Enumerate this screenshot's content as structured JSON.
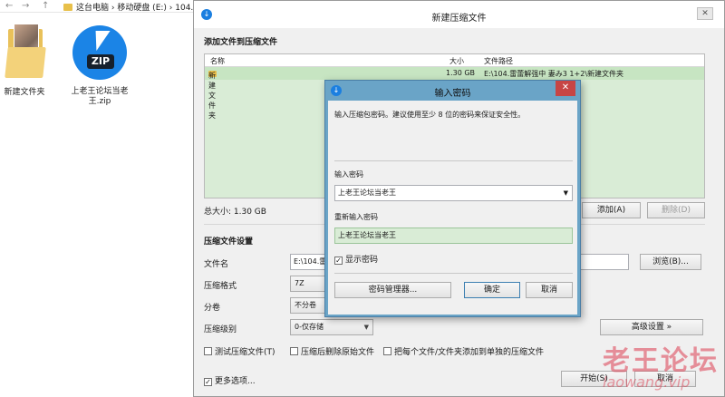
{
  "explorer": {
    "breadcrumb": "这台电脑 › 移动硬盘 (E:) › 104.雷蕾解强中",
    "desktop_items": [
      {
        "label": "新建文件夹"
      },
      {
        "label": "上老王论坛当老王.zip"
      }
    ],
    "zip_badge": "ZIP"
  },
  "main_window": {
    "title": "新建压缩文件",
    "close": "✕",
    "add_section_title": "添加文件到压缩文件",
    "list_headers": {
      "name": "名称",
      "size": "大小",
      "path": "文件路径"
    },
    "files": [
      {
        "name": "新建文件夹",
        "size": "1.30 GB",
        "path": "E:\\104.雷蕾解强中 妻み3 1+2\\新建文件夹"
      }
    ],
    "total_size": "总大小: 1.30 GB",
    "add_button": "添加(A)",
    "delete_button": "删除(D)",
    "settings_title": "压缩文件设置",
    "filename_label": "文件名",
    "filename_value": "E:\\104.雷",
    "browse_button": "浏览(B)...",
    "format_label": "压缩格式",
    "format_value": "7Z",
    "split_label": "分卷",
    "split_value": "不分卷",
    "level_label": "压缩级别",
    "level_value": "0-仅存储",
    "advanced_button": "高级设置 »",
    "test_checkbox": "测试压缩文件(T)",
    "delete_after_checkbox": "压缩后删除原始文件",
    "separate_checkbox": "把每个文件/文件夹添加到单独的压缩文件",
    "more_options": "更多选项...",
    "start_button": "开始(S)",
    "cancel_button": "取消"
  },
  "password_dialog": {
    "title": "输入密码",
    "close": "✕",
    "hint": "输入压缩包密码。建议使用至少 8 位的密码来保证安全性。",
    "enter_label": "输入密码",
    "password_value": "上老王论坛当老王",
    "reenter_label": "重新输入密码",
    "reenter_value": "上老王论坛当老王",
    "show_password": "显示密码",
    "manager_button": "密码管理器...",
    "ok_button": "确定",
    "cancel_button": "取消"
  },
  "watermark": {
    "text": "老王论坛",
    "sub": "laowang.vip"
  },
  "colors": {
    "list_bg": "#d9ecd6",
    "dialog_frame": "#6aa4c7",
    "close_red": "#c74545",
    "app_blue": "#1b7fe0"
  }
}
